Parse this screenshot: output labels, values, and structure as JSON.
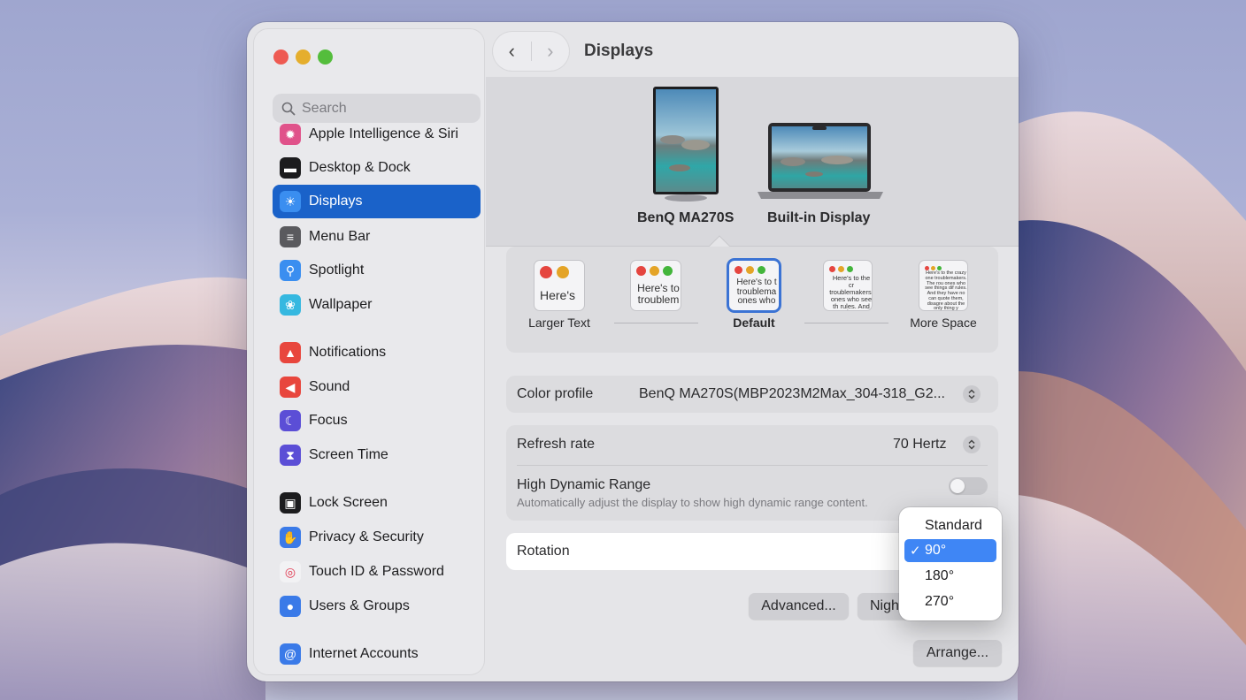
{
  "window": {
    "title": "Displays"
  },
  "sidebar": {
    "search_placeholder": "Search",
    "items": [
      {
        "label": "Apple Intelligence & Siri",
        "icon": "siri-icon",
        "color": "#e0528a"
      },
      {
        "label": "Desktop & Dock",
        "icon": "dock-icon",
        "color": "#1c1c1e"
      },
      {
        "label": "Displays",
        "icon": "sun-icon",
        "color": "#3a8ef0",
        "active": true
      },
      {
        "label": "Menu Bar",
        "icon": "toggles-icon",
        "color": "#5a5a5e"
      },
      {
        "label": "Spotlight",
        "icon": "magnifier-icon",
        "color": "#3a8ef0"
      },
      {
        "label": "Wallpaper",
        "icon": "flower-icon",
        "color": "#35b8e0"
      },
      {
        "label": "Notifications",
        "icon": "bell-icon",
        "color": "#e8463d"
      },
      {
        "label": "Sound",
        "icon": "speaker-icon",
        "color": "#e8463d"
      },
      {
        "label": "Focus",
        "icon": "moon-icon",
        "color": "#5b4ed6"
      },
      {
        "label": "Screen Time",
        "icon": "hourglass-icon",
        "color": "#5b4ed6"
      },
      {
        "label": "Lock Screen",
        "icon": "lock-icon",
        "color": "#1c1c1e"
      },
      {
        "label": "Privacy & Security",
        "icon": "hand-icon",
        "color": "#3a7ae8"
      },
      {
        "label": "Touch ID & Password",
        "icon": "fingerprint-icon",
        "color": "#f2f2f4"
      },
      {
        "label": "Users & Groups",
        "icon": "users-icon",
        "color": "#3a7ae8"
      },
      {
        "label": "Internet Accounts",
        "icon": "at-icon",
        "color": "#3a7ae8"
      }
    ]
  },
  "displays": {
    "external": "BenQ MA270S",
    "builtin": "Built-in Display"
  },
  "scaling": {
    "options": [
      "Larger Text",
      "",
      "Default",
      "",
      "More Space"
    ],
    "thumb_texts": [
      "Here's",
      "Here's to troublem",
      "Here's to t troublema ones who",
      "Here's to the cr troublemakers. ones who see th rules. And they",
      "Here's to the crazy one troublemakers. The rou ones who see things dif rules. And they have no can quote them, disagre about the only thing y Because they change thi"
    ],
    "selected": "Default"
  },
  "color_profile": {
    "label": "Color profile",
    "value": "BenQ MA270S(MBP2023M2Max_304-318_G2..."
  },
  "refresh_rate": {
    "label": "Refresh rate",
    "value": "70 Hertz"
  },
  "hdr": {
    "label": "High Dynamic Range",
    "description": "Automatically adjust the display to show high dynamic range content.",
    "enabled": false
  },
  "rotation": {
    "label": "Rotation",
    "options": [
      "Standard",
      "90°",
      "180°",
      "270°"
    ],
    "selected": "90°",
    "check": "✓"
  },
  "buttons": {
    "advanced": "Advanced...",
    "night_shift": "Nigh",
    "arrange": "Arrange..."
  }
}
